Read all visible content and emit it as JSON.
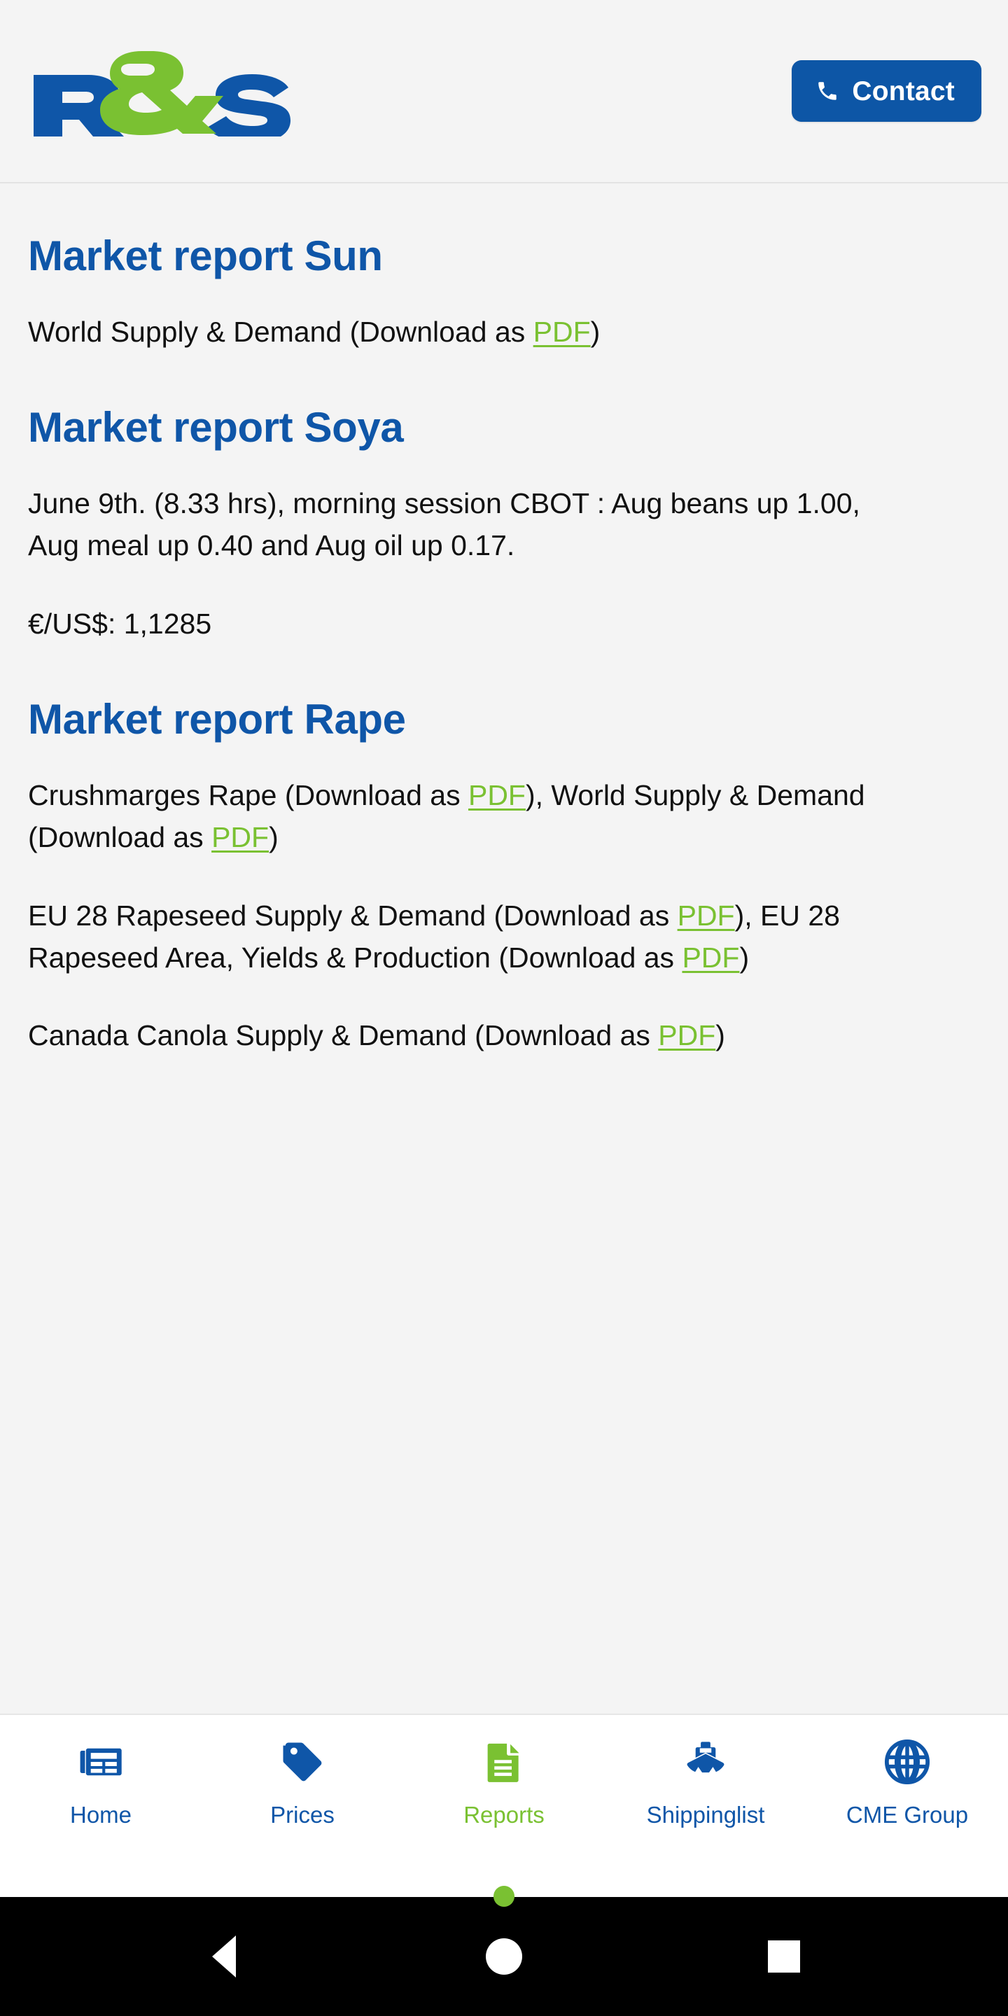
{
  "header": {
    "logo_alt": "R&S",
    "logo_letters": {
      "first": "R",
      "amp": "&",
      "last": "S"
    },
    "contact_label": "Contact",
    "colors": {
      "blue": "#0d56a6",
      "green": "#7ac132",
      "logo_blue": "#0f56a8"
    }
  },
  "reports": [
    {
      "heading": "Market report Sun",
      "paragraphs": [
        [
          {
            "t": "World Supply & Demand (Download as "
          },
          {
            "t": "PDF",
            "link": true
          },
          {
            "t": ")"
          }
        ]
      ]
    },
    {
      "heading": "Market report Soya",
      "paragraphs": [
        [
          {
            "t": "June 9th. (8.33 hrs), morning session CBOT : Aug beans up 1.00, Aug meal up 0.40 and Aug oil up 0.17."
          }
        ],
        [
          {
            "t": "€/US$: 1,1285"
          }
        ]
      ]
    },
    {
      "heading": "Market report Rape",
      "paragraphs": [
        [
          {
            "t": "Crushmarges Rape (Download as "
          },
          {
            "t": "PDF",
            "link": true
          },
          {
            "t": "), World Supply & Demand (Download as "
          },
          {
            "t": "PDF",
            "link": true
          },
          {
            "t": ")"
          }
        ],
        [
          {
            "t": "EU 28 Rapeseed Supply & Demand (Download as "
          },
          {
            "t": "PDF",
            "link": true
          },
          {
            "t": "), EU 28 Rapeseed Area, Yields & Production (Download as "
          },
          {
            "t": "PDF",
            "link": true
          },
          {
            "t": ")"
          }
        ],
        [
          {
            "t": "Canada Canola Supply & Demand (Download as "
          },
          {
            "t": "PDF",
            "link": true
          },
          {
            "t": ")"
          }
        ]
      ]
    }
  ],
  "tab_bar": {
    "active_index": 2,
    "items": [
      {
        "label": "Home",
        "icon": "newspaper-icon",
        "active": false
      },
      {
        "label": "Prices",
        "icon": "price-tag-icon",
        "active": false
      },
      {
        "label": "Reports",
        "icon": "document-icon",
        "active": true
      },
      {
        "label": "Shippinglist",
        "icon": "ship-icon",
        "active": false
      },
      {
        "label": "CME Group",
        "icon": "globe-icon",
        "active": false
      }
    ]
  },
  "system_nav": {
    "back_label": "Back",
    "home_label": "Home",
    "recents_label": "Recent apps"
  }
}
